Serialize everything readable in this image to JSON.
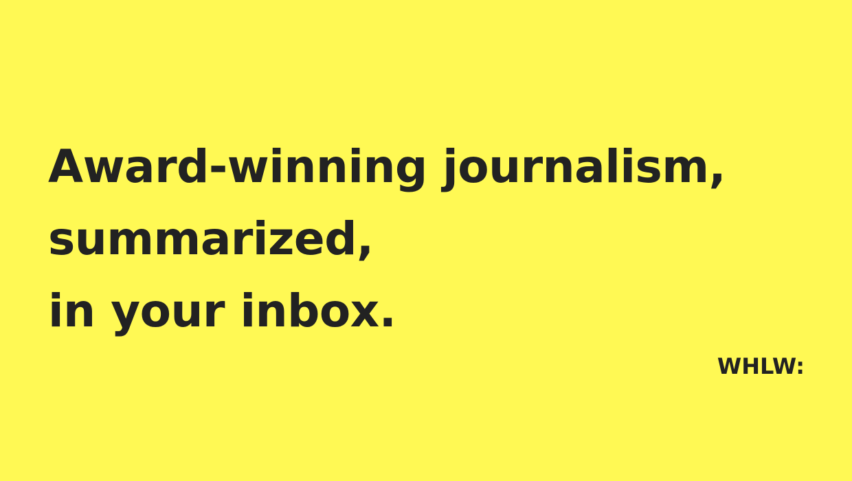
{
  "headline": {
    "lines": [
      "Award-winning journalism,",
      "summarized,",
      "in your inbox."
    ]
  },
  "brand": {
    "label": "WHLW:"
  },
  "colors": {
    "background": "#FFF954",
    "text": "#222222"
  }
}
